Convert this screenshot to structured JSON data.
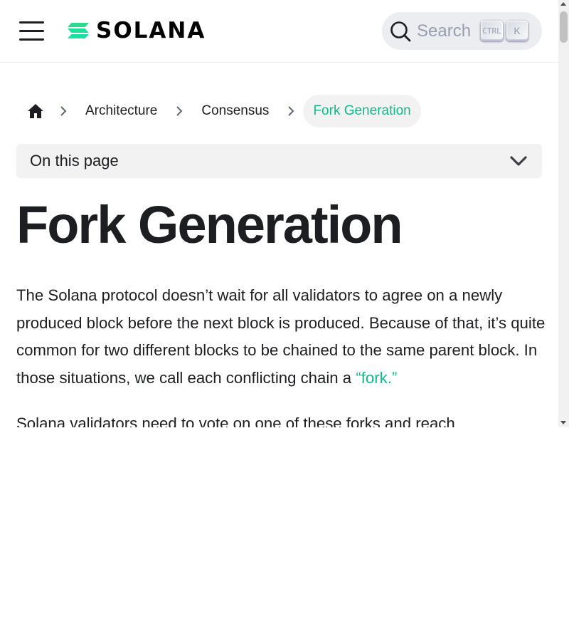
{
  "navbar": {
    "brand": "SOLANA",
    "brand_colors": [
      "#00FFA3",
      "#19FB9B",
      "#03E1FF"
    ],
    "menu_icon": "hamburger-menu-icon",
    "search": {
      "placeholder": "Search",
      "icon": "search-icon",
      "shortcut_ctrl": "CTRL",
      "shortcut_key": "K"
    }
  },
  "breadcrumb": {
    "home_icon": "home-icon",
    "separator_icon": "chevron-right-icon",
    "items": [
      {
        "label": "Architecture"
      },
      {
        "label": "Consensus"
      },
      {
        "label": "Fork Generation",
        "active": true
      }
    ]
  },
  "toc": {
    "label": "On this page",
    "icon": "chevron-down-icon"
  },
  "article": {
    "title": "Fork Generation",
    "paragraph1_text": "The Solana protocol doesn’t wait for all validators to agree on a newly produced block before the next block is produced. Because of that, it’s quite common for two different blocks to be chained to the same parent block. In those situations, we call each conflicting chain a ",
    "paragraph1_link": "“fork.”",
    "paragraph2_text": "Solana validators need to vote on one of these forks and reach"
  },
  "colors": {
    "accent": "#14b88a",
    "text": "#1c1e21",
    "surface": "#f2f2f2"
  }
}
